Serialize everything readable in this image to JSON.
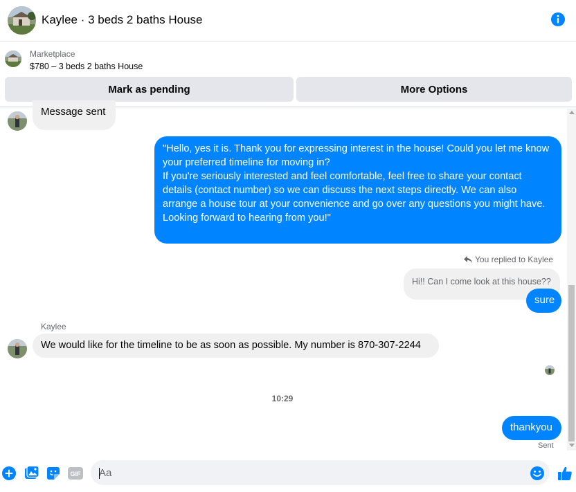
{
  "header": {
    "title": "Kaylee · 3 beds 2 baths House"
  },
  "listing": {
    "source": "Marketplace",
    "description": "$780 – 3 beds 2 baths House"
  },
  "actions": {
    "pending_label": "Mark as pending",
    "more_label": "More Options"
  },
  "messages": {
    "system_sent": "Message sent",
    "long_reply": "\"Hello, yes it is. Thank you for expressing interest in the house! Could you let me know your preferred timeline for moving in?\nIf you're seriously interested and feel comfortable, feel free to share your contact details (contact number) so we can discuss the next steps directly. We can also arrange a house tour at your convenience and go over any questions you might have.\nLooking forward to hearing from you!\"",
    "reply_label": "You replied to Kaylee",
    "quoted_message": "Hi!! Can I come look at this house??",
    "sure": "sure",
    "sender_name": "Kaylee",
    "kaylee_message": "We would like for the timeline to be as soon as possible. My number is 870-307-2244",
    "timestamp": "10:29",
    "thankyou": "thankyou",
    "status": "Sent"
  },
  "composer": {
    "placeholder": "Aa",
    "icons": [
      "plus-icon",
      "photo-icon",
      "sticker-icon",
      "gif-icon",
      "emoji-icon",
      "thumbs-up-icon"
    ],
    "gif_label": "GIF"
  },
  "colors": {
    "accent": "#0084ff",
    "incoming_bubble": "#f0f0f0",
    "button_bg": "#e4e6eb",
    "muted_text": "#65676b"
  }
}
